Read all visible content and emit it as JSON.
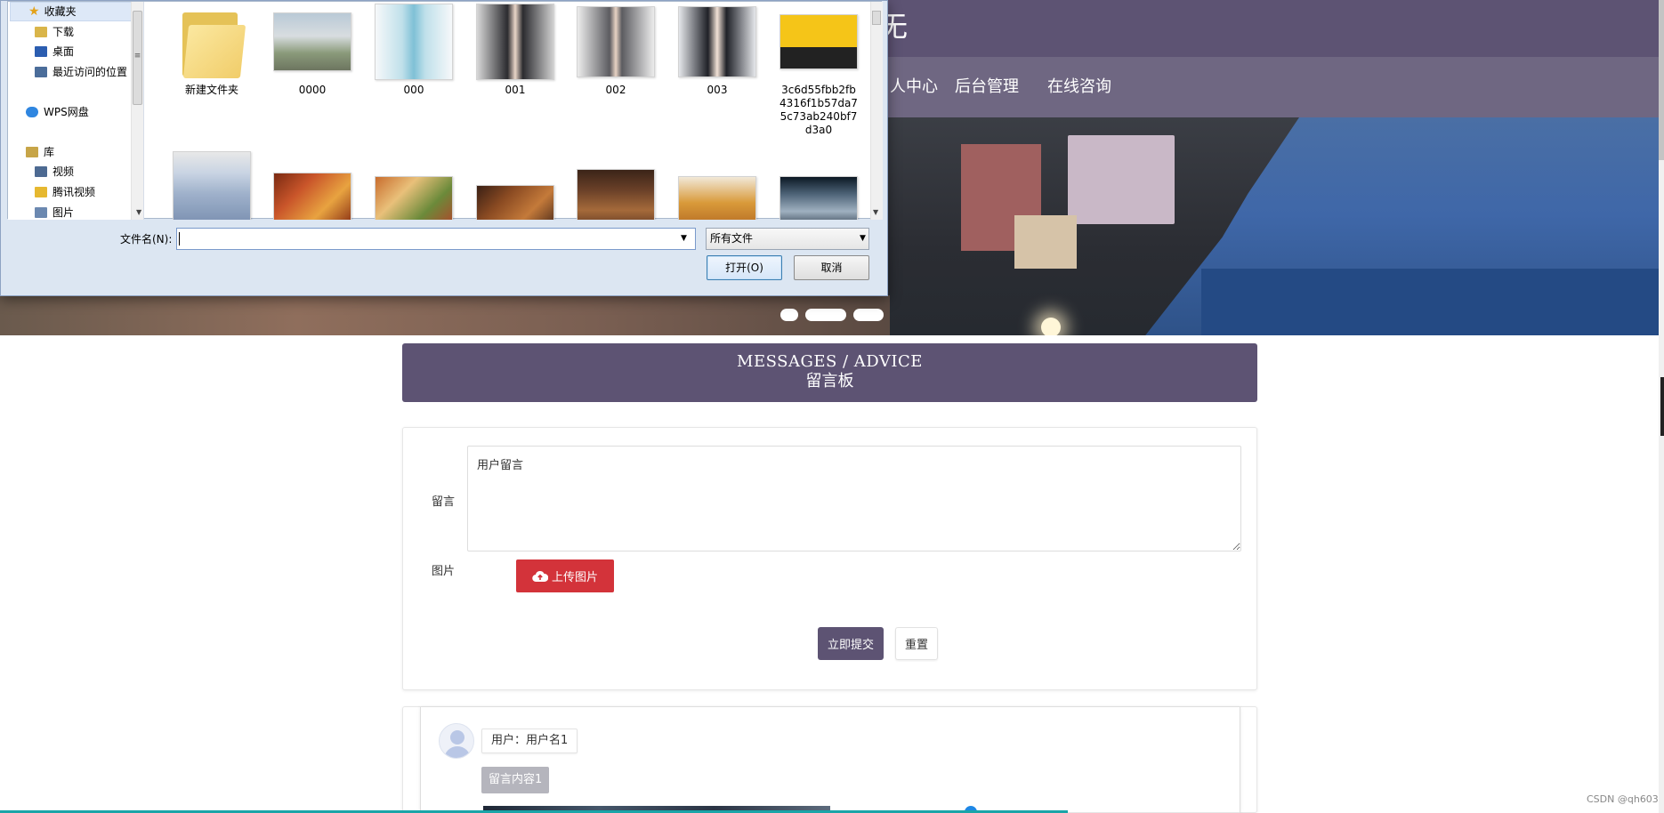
{
  "site": {
    "title_fragment": "无",
    "nav": [
      "人中心",
      "后台管理",
      "在线咨询"
    ]
  },
  "messages": {
    "header_en": "MESSAGES / ADVICE",
    "header_zh": "留言板"
  },
  "form": {
    "message_label": "留言",
    "message_value": "用户留言",
    "image_label": "图片",
    "upload_label": "上传图片",
    "submit_label": "立即提交",
    "reset_label": "重置"
  },
  "list": {
    "user_text": "用户：用户名1",
    "content_text": "留言内容1"
  },
  "watermark": "CSDN @qh603",
  "dialog": {
    "nav_items": [
      {
        "label": "收藏夹",
        "icon": "star-icon"
      },
      {
        "label": "下载",
        "icon": "download-folder-icon"
      },
      {
        "label": "桌面",
        "icon": "desktop-icon"
      },
      {
        "label": "最近访问的位置",
        "icon": "recent-places-icon"
      },
      {
        "label": "WPS网盘",
        "icon": "cloud-drive-icon"
      },
      {
        "label": "库",
        "icon": "library-icon"
      },
      {
        "label": "视频",
        "icon": "video-library-icon"
      },
      {
        "label": "腾讯视频",
        "icon": "tencent-video-icon"
      },
      {
        "label": "图片",
        "icon": "pictures-library-icon"
      }
    ],
    "files": [
      {
        "name": "新建文件夹",
        "kind": "folder"
      },
      {
        "name": "0000",
        "kind": "image"
      },
      {
        "name": "000",
        "kind": "image"
      },
      {
        "name": "001",
        "kind": "image"
      },
      {
        "name": "002",
        "kind": "image"
      },
      {
        "name": "003",
        "kind": "image"
      },
      {
        "name": "3c6d55fbb2fb4316f1b57da75c73ab240bf7d3a0",
        "kind": "image"
      }
    ],
    "filename_label": "文件名(N):",
    "filename_value": "",
    "filetype_value": "所有文件",
    "open_label": "打开(O)",
    "cancel_label": "取消"
  },
  "colors": {
    "brand_purple": "#5d5373",
    "upload_red": "#d3333a",
    "accent_teal": "#1aa5a8"
  }
}
